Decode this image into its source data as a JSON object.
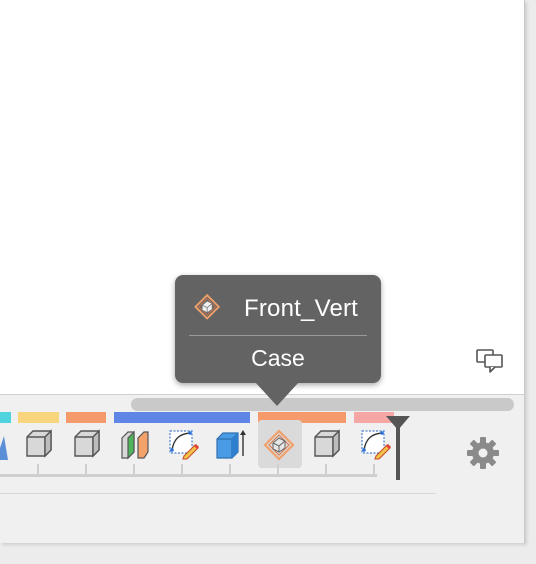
{
  "tooltip": {
    "title": "Front_Vert",
    "subtitle": "Case",
    "icon": "plane-feature-icon"
  },
  "timeline": {
    "color_groups": [
      {
        "color": "#4fd4df"
      },
      {
        "color": "#f9d67e"
      },
      {
        "color": "#f59a6b"
      },
      {
        "color": "#5f85e6"
      },
      {
        "color": "#f59a6b"
      },
      {
        "color": "#f7a6a6"
      }
    ],
    "features": [
      {
        "icon": "sketch-partial-icon"
      },
      {
        "icon": "box-feature-icon"
      },
      {
        "icon": "box-feature-icon"
      },
      {
        "icon": "split-body-icon"
      },
      {
        "icon": "sketch-icon"
      },
      {
        "icon": "extrude-icon"
      },
      {
        "icon": "plane-feature-icon",
        "selected": true
      },
      {
        "icon": "box-feature-icon"
      },
      {
        "icon": "sketch-icon"
      }
    ],
    "settings_icon": "gear-icon",
    "marker_icon": "timeline-marker-icon"
  },
  "canvas": {
    "comments_icon": "comments-icon"
  },
  "colors": {
    "tooltip_bg": "#636363",
    "timeline_bg": "#f0f0f0",
    "track": "#cfcfcf"
  }
}
